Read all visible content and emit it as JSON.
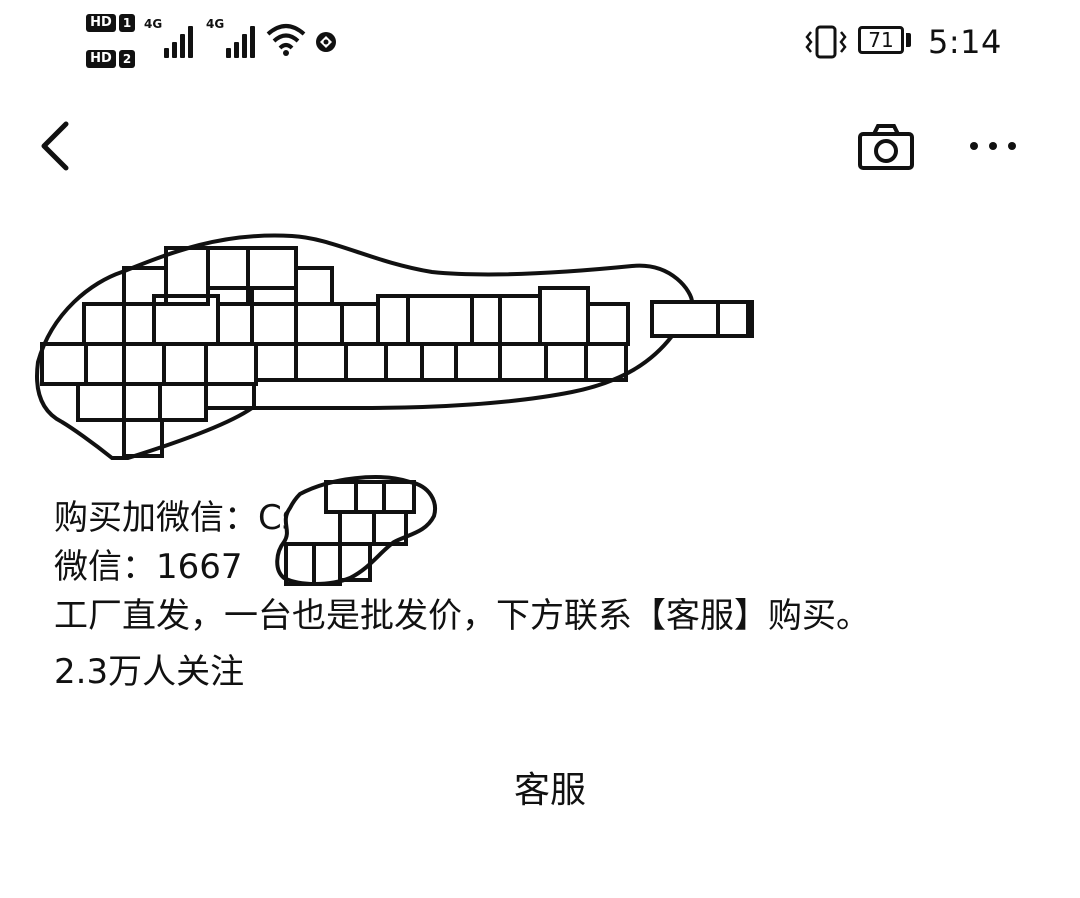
{
  "status_bar": {
    "sim1_badge": "HD",
    "sim1_number": "1",
    "sim2_badge": "HD",
    "sim2_number": "2",
    "network1": "4G",
    "network2": "4G",
    "battery_level": "71",
    "time": "5:14",
    "icons": [
      "hd-icon",
      "signal-icon",
      "wifi-icon",
      "vpn-icon",
      "vibrate-icon",
      "battery-icon"
    ]
  },
  "nav": {
    "icons": [
      "back-icon",
      "camera-icon",
      "more-icon"
    ]
  },
  "profile": {
    "bio_lines": [
      "购买加微信：Cs",
      "微信：1667",
      "工厂直发，一台也是批发价，下方联系【客服】购买。"
    ],
    "followers": "2.3万人关注"
  },
  "service_button": {
    "label": "客服"
  }
}
